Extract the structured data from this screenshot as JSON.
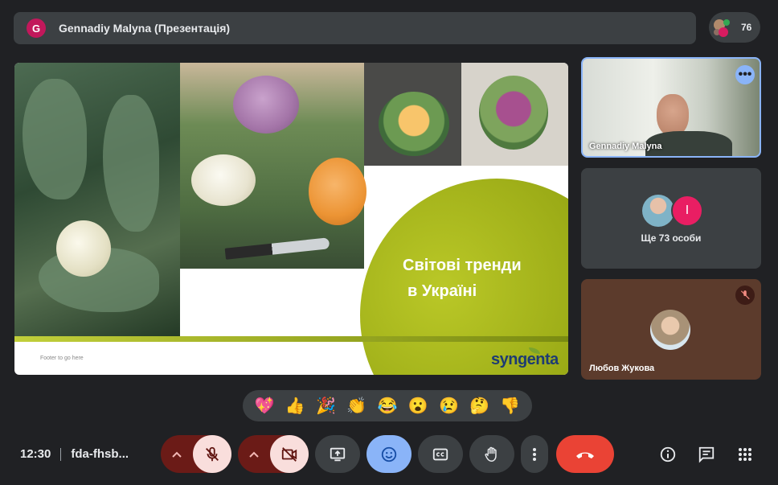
{
  "presenter_bar": {
    "avatar_letter": "G",
    "title": "Gennadiy Malyna (Презентація)"
  },
  "participants": {
    "count": "76"
  },
  "slide": {
    "heading_line1": "Світові тренди",
    "heading_line2": "в Україні",
    "footer": "Footer to go here",
    "brand": "syngenta",
    "colors": {
      "accent_green": "#9aaa16",
      "brand_blue": "#1d3b73"
    }
  },
  "tiles": [
    {
      "name": "Gennadiy Malyna",
      "more_icon": "more-horiz-icon"
    },
    {
      "avatar_letter": "І",
      "label": "Ще 73 особи"
    },
    {
      "name": "Любов Жукова",
      "muted": true
    }
  ],
  "reactions": [
    "💖",
    "👍",
    "🎉",
    "👏",
    "😂",
    "😮",
    "😢",
    "🤔",
    "👎"
  ],
  "meeting": {
    "time": "12:30",
    "code": "fda-fhsb..."
  },
  "controls": {
    "mic": "mic-off-icon",
    "camera": "videocam-off-icon",
    "present": "present-screen-icon",
    "emoji": "emoji-icon",
    "captions": "captions-icon",
    "raise_hand": "raise-hand-icon",
    "more": "more-vert-icon",
    "end_call": "call-end-icon",
    "info": "info-icon",
    "chat": "chat-icon",
    "activities": "apps-icon"
  }
}
